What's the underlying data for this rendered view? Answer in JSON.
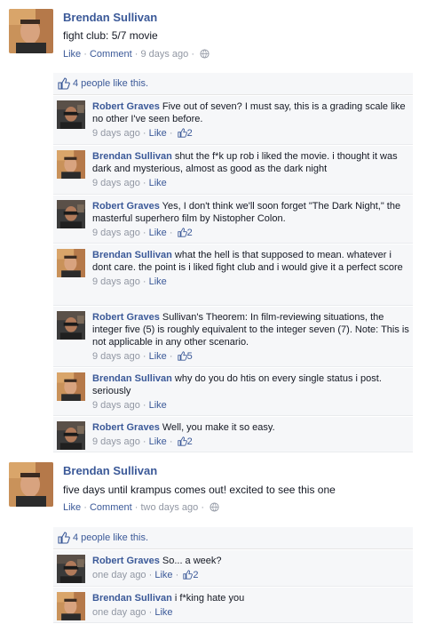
{
  "posts": [
    {
      "author": "Brendan Sullivan",
      "status": "fight club: 5/7 movie",
      "like": "Like",
      "comment": "Comment",
      "time": "9 days ago",
      "likes_text": "4 people like this.",
      "comments": [
        {
          "name": "Robert Graves",
          "text": "Five out of seven? I must say, this is a grading scale like no other I've seen before.",
          "time": "9 days ago",
          "like": "Like",
          "likes": "2",
          "avatar": "robert"
        },
        {
          "name": "Brendan Sullivan",
          "text": "shut the f*k up rob i liked the movie. i thought it was dark and mysterious, almost as good as the dark night",
          "time": "9 days ago",
          "like": "Like",
          "likes": "",
          "avatar": "brendan"
        },
        {
          "name": "Robert Graves",
          "text": "Yes, I don't think we'll soon forget \"The Dark Night,\" the masterful superhero film by Nistopher Colon.",
          "time": "9 days ago",
          "like": "Like",
          "likes": "2",
          "avatar": "robert"
        },
        {
          "name": "Brendan Sullivan",
          "text": "what the hell is that supposed to mean. whatever i dont care. the point is i liked fight club and i would give it a perfect score",
          "time": "9 days ago",
          "like": "Like",
          "likes": "",
          "avatar": "brendan"
        },
        {
          "name": "Robert Graves",
          "text": "Sullivan's Theorem: In film-reviewing situations, the integer five (5) is roughly equivalent to the integer seven (7). Note: This is not applicable in any other scenario.",
          "time": "9 days ago",
          "like": "Like",
          "likes": "5",
          "avatar": "robert"
        },
        {
          "name": "Brendan Sullivan",
          "text": "why do you do htis on every single status i post. seriously",
          "time": "9 days ago",
          "like": "Like",
          "likes": "",
          "avatar": "brendan"
        },
        {
          "name": "Robert Graves",
          "text": "Well, you make it so easy.",
          "time": "9 days ago",
          "like": "Like",
          "likes": "2",
          "avatar": "robert"
        }
      ]
    },
    {
      "author": "Brendan Sullivan",
      "status": "five days until krampus comes out! excited to see this one",
      "like": "Like",
      "comment": "Comment",
      "time": "two days ago",
      "likes_text": "4 people like this.",
      "comments": [
        {
          "name": "Robert Graves",
          "text": "So... a week?",
          "time": "one day ago",
          "like": "Like",
          "likes": "2",
          "avatar": "robert"
        },
        {
          "name": "Brendan Sullivan",
          "text": "i f*king hate you",
          "time": "one day ago",
          "like": "Like",
          "likes": "",
          "avatar": "brendan"
        }
      ]
    }
  ],
  "colors": {
    "link": "#3b5998",
    "muted": "#9197a3",
    "panel": "#f6f7f9"
  }
}
